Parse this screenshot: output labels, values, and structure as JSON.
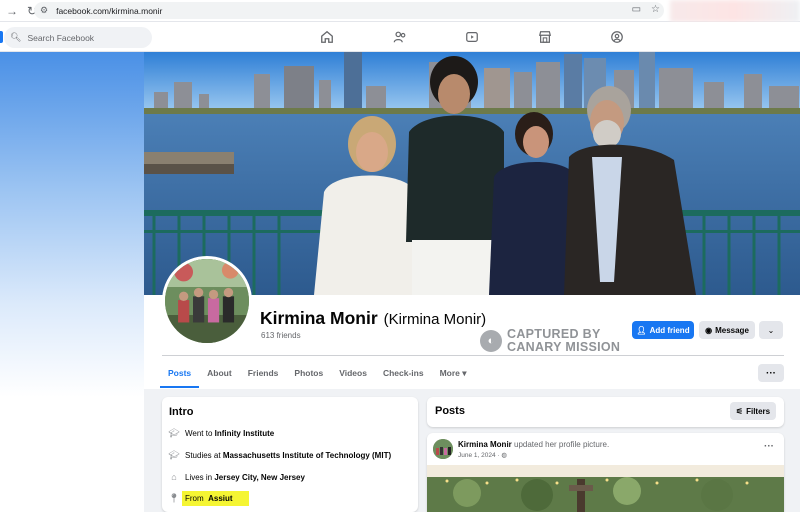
{
  "browser": {
    "url": "facebook.com/kirmina.monir"
  },
  "search": {
    "placeholder": "Search Facebook"
  },
  "profile": {
    "name": "Kirmina Monir",
    "alternate_name": "(Kirmina Monir)",
    "friends": "613 friends"
  },
  "watermark": {
    "line1": "CAPTURED BY",
    "line2": "CANARY MISSION"
  },
  "actions": {
    "add_friend": "Add friend",
    "message": "Message"
  },
  "tabs": [
    {
      "label": "Posts",
      "active": true
    },
    {
      "label": "About"
    },
    {
      "label": "Friends"
    },
    {
      "label": "Photos"
    },
    {
      "label": "Videos"
    },
    {
      "label": "Check-ins"
    },
    {
      "label": "More"
    }
  ],
  "intro": {
    "title": "Intro",
    "items": [
      {
        "icon": "graduation-cap-icon",
        "prefix": "Went to ",
        "bold": "Infinity Institute"
      },
      {
        "icon": "graduation-cap-icon",
        "prefix": "Studies at ",
        "bold": "Massachusetts Institute of Technology (MIT)"
      },
      {
        "icon": "home-icon",
        "prefix": "Lives in ",
        "bold": "Jersey City, New Jersey"
      },
      {
        "icon": "location-pin-icon",
        "prefix": "From ",
        "bold": "Assiut"
      }
    ]
  },
  "posts": {
    "title": "Posts",
    "filters_label": "Filters",
    "first_post": {
      "author": "Kirmina Monir",
      "action": " updated her profile picture.",
      "date": "June 1, 2024 ·"
    }
  },
  "colors": {
    "accent": "#1877f2",
    "highlight": "#f5f533"
  }
}
